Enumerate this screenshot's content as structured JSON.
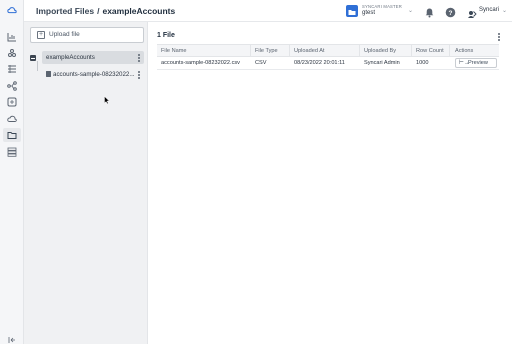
{
  "header": {
    "breadcrumb_parent": "Imported Files",
    "breadcrumb_sep": "/",
    "breadcrumb_current": "exampleAccounts",
    "org_label": "SYNCARI MASTER",
    "org_name": "gtest",
    "user_name": "Syncari"
  },
  "rail": {
    "icons": [
      "logo-icon",
      "dashboard-icon",
      "synapse-icon",
      "entities-icon",
      "pipeline-icon",
      "functions-icon",
      "cloud-icon",
      "imported-files-icon",
      "database-icon"
    ]
  },
  "sidebar": {
    "upload_label": "Upload file",
    "folder_name": "exampleAccounts",
    "file_name": "accounts-sample-08232022..."
  },
  "main": {
    "file_count": "1 File",
    "columns": [
      "File Name",
      "File Type",
      "Uploaded At",
      "Uploaded By",
      "Row Count",
      "Actions"
    ],
    "rows": [
      {
        "file_name": "accounts-sample-08232022.csv",
        "file_type": "CSV",
        "uploaded_at": "08/23/2022 20:01:11",
        "uploaded_by": "Syncari Admin",
        "row_count": "1000",
        "action": "Preview"
      }
    ]
  },
  "colors": {
    "accent": "#2f6fd6",
    "rail_bg": "#f5f6f8",
    "panel_bg": "#f0f1f3"
  }
}
